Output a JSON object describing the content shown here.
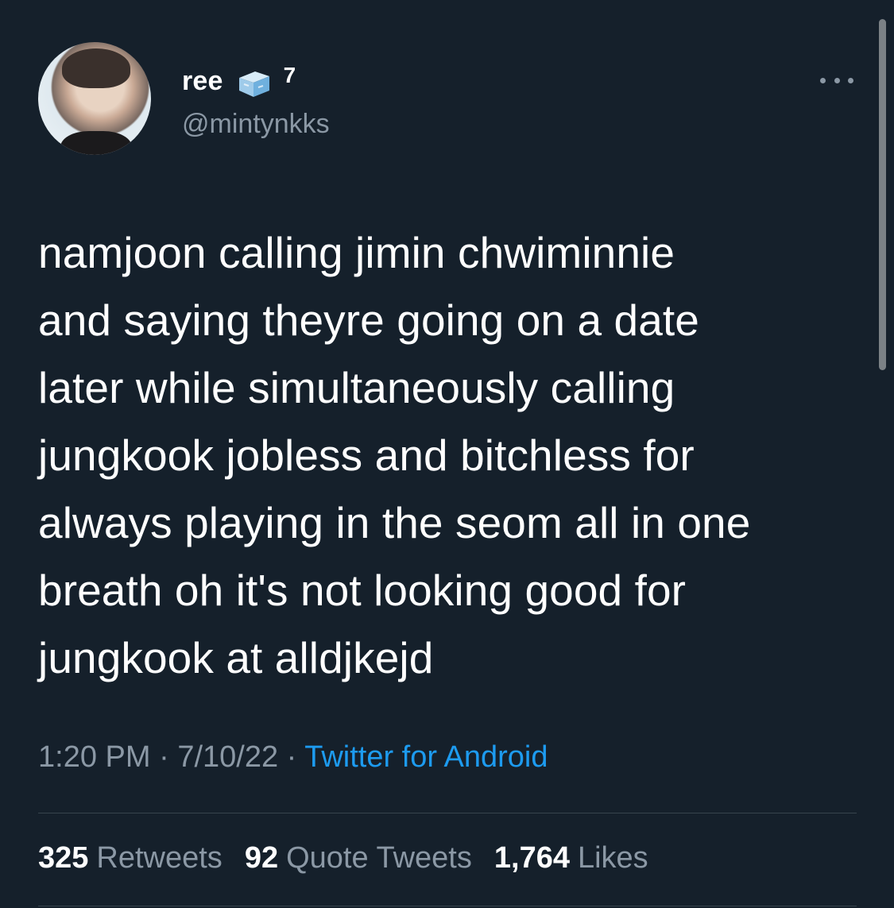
{
  "author": {
    "display_name": "ree",
    "name_emoji_icon": "ice-cube-icon",
    "name_suffix": "7",
    "handle": "@mintynkks"
  },
  "tweet": {
    "text": "namjoon calling jimin chwiminnie\nand saying theyre going on a date\nlater while simultaneously calling\njungkook jobless and bitchless for\nalways playing in the seom all in one\nbreath oh it's not looking good for\njungkook at alldjkejd",
    "time": "1:20 PM",
    "separator": "·",
    "date": "7/10/22",
    "source": "Twitter for Android"
  },
  "stats": {
    "retweets_count": "325",
    "retweets_label": "Retweets",
    "quotes_count": "92",
    "quotes_label": "Quote Tweets",
    "likes_count": "1,764",
    "likes_label": "Likes"
  },
  "colors": {
    "background": "#15202b",
    "secondary_text": "#8b98a5",
    "link": "#1d9bf0"
  }
}
